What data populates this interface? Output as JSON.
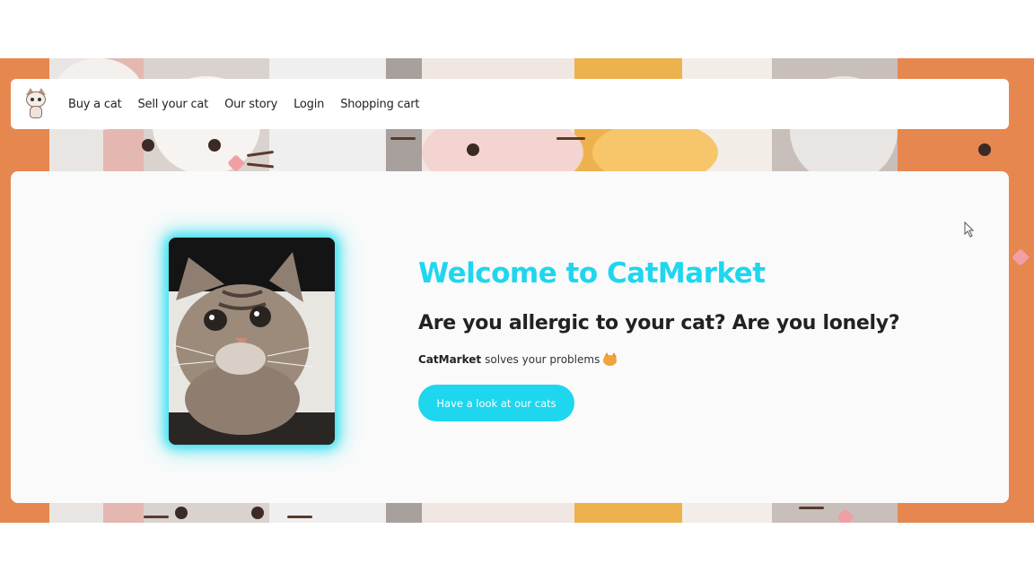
{
  "nav": {
    "logo_icon": "cat-logo-icon",
    "links": [
      "Buy a cat",
      "Sell your cat",
      "Our story",
      "Login",
      "Shopping cart"
    ]
  },
  "hero": {
    "title": "Welcome to CatMarket",
    "subtitle": "Are you allergic to your cat? Are you lonely?",
    "brand": "CatMarket",
    "tagline": "solves your problems",
    "tagline_icon": "smiling-cat-emoji-icon",
    "cta_label": "Have a look at our cats",
    "image_icon": "tabby-cat-photo"
  },
  "colors": {
    "accent": "#1ed6ee",
    "text": "#222222",
    "card_bg": "#fafafa"
  }
}
